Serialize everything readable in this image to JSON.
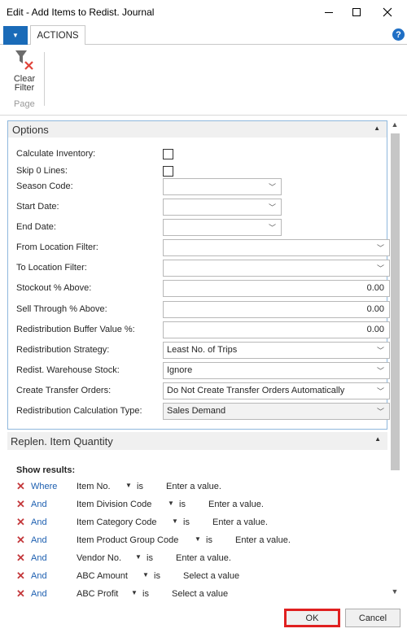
{
  "window": {
    "title": "Edit - Add Items to Redist. Journal"
  },
  "ribbon": {
    "tab": "ACTIONS",
    "clear_filter_line1": "Clear",
    "clear_filter_line2": "Filter",
    "group": "Page",
    "help": "?"
  },
  "options": {
    "title": "Options",
    "fields": [
      {
        "label": "Calculate Inventory:",
        "type": "checkbox",
        "checked": false
      },
      {
        "label": "Skip 0 Lines:",
        "type": "checkbox",
        "checked": false
      },
      {
        "label": "Season Code:",
        "type": "select-short",
        "value": ""
      },
      {
        "label": "Start Date:",
        "type": "select-short",
        "value": ""
      },
      {
        "label": "End Date:",
        "type": "select-short",
        "value": ""
      },
      {
        "label": "From Location Filter:",
        "type": "select",
        "value": ""
      },
      {
        "label": "To Location Filter:",
        "type": "select",
        "value": ""
      },
      {
        "label": "Stockout % Above:",
        "type": "number",
        "value": "0.00"
      },
      {
        "label": "Sell Through % Above:",
        "type": "number",
        "value": "0.00"
      },
      {
        "label": "Redistribution Buffer Value %:",
        "type": "number",
        "value": "0.00"
      },
      {
        "label": "Redistribution Strategy:",
        "type": "select",
        "value": "Least No. of Trips"
      },
      {
        "label": "Redist. Warehouse Stock:",
        "type": "select",
        "value": "Ignore"
      },
      {
        "label": "Create Transfer Orders:",
        "type": "select",
        "value": "Do Not Create Transfer Orders Automatically"
      },
      {
        "label": "Redistribution Calculation Type:",
        "type": "select-grey",
        "value": "Sales Demand"
      }
    ]
  },
  "replen": {
    "title": "Replen. Item Quantity",
    "show_results": "Show results:",
    "filters": [
      {
        "conj": "Where",
        "field": "Item No.",
        "op": "is",
        "value": "Enter a value."
      },
      {
        "conj": "And",
        "field": "Item Division Code",
        "op": "is",
        "value": "Enter a value."
      },
      {
        "conj": "And",
        "field": "Item Category Code",
        "op": "is",
        "value": "Enter a value."
      },
      {
        "conj": "And",
        "field": "Item Product Group Code",
        "op": "is",
        "value": "Enter a value."
      },
      {
        "conj": "And",
        "field": "Vendor No.",
        "op": "is",
        "value": "Enter a value."
      },
      {
        "conj": "And",
        "field": "ABC Amount",
        "op": "is",
        "value": "Select a value"
      },
      {
        "conj": "And",
        "field": "ABC Profit",
        "op": "is",
        "value": "Select a value"
      }
    ]
  },
  "buttons": {
    "ok": "OK",
    "cancel": "Cancel"
  },
  "colors": {
    "accent": "#1a6bb8",
    "link": "#1d5fb0",
    "remove": "#c4393c",
    "highlight": "#e02020"
  }
}
